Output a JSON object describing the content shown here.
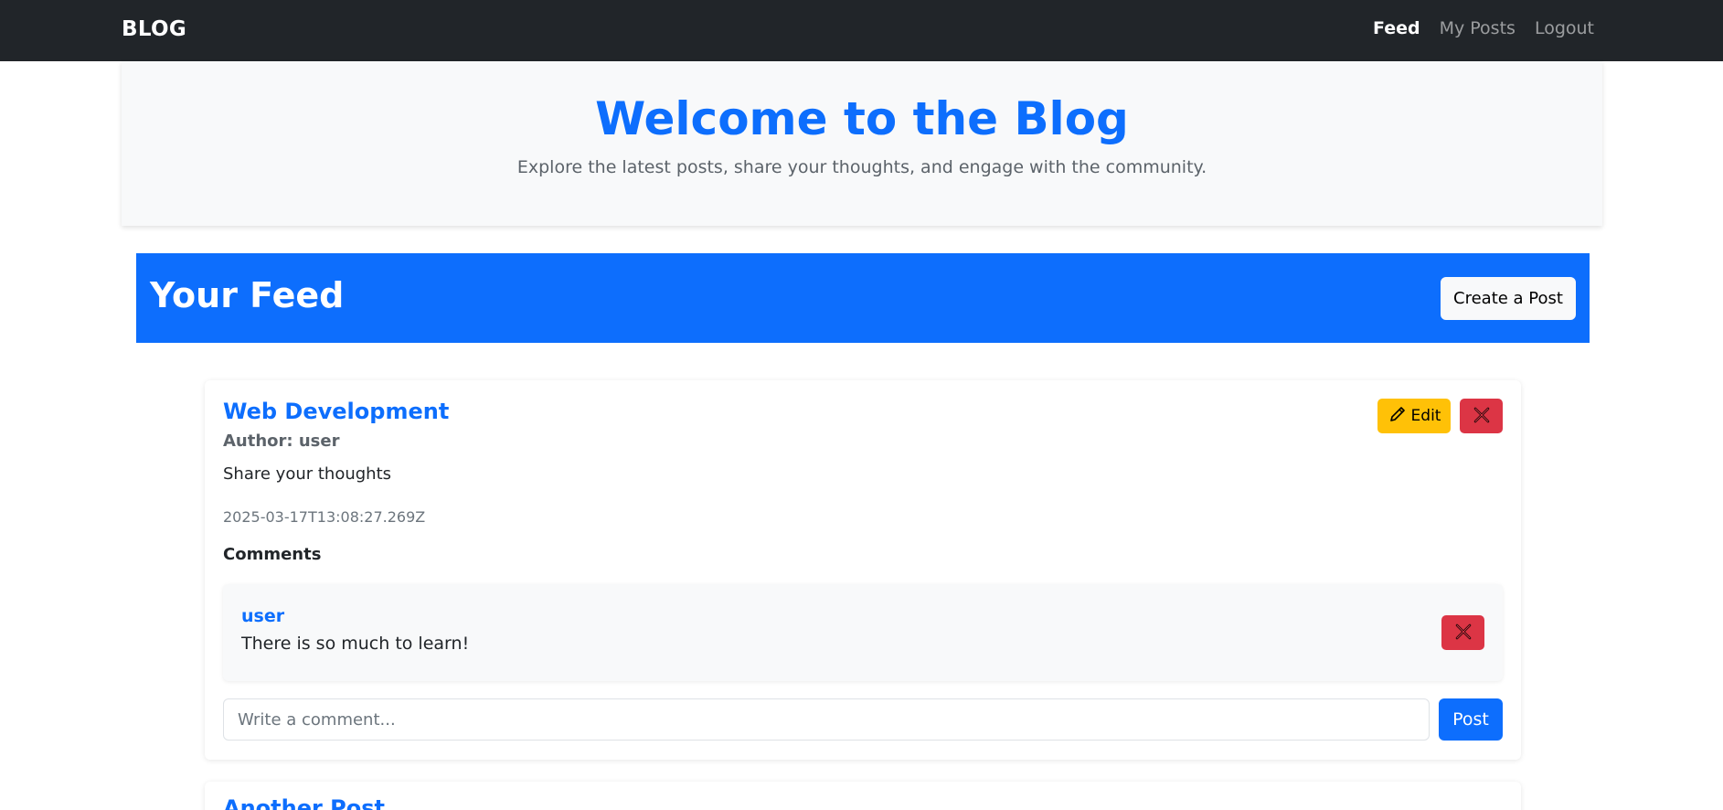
{
  "navbar": {
    "brand": "BLOG",
    "links": [
      {
        "label": "Feed",
        "active": true
      },
      {
        "label": "My Posts",
        "active": false
      },
      {
        "label": "Logout",
        "active": false
      }
    ]
  },
  "hero": {
    "title": "Welcome to the Blog",
    "subtitle": "Explore the latest posts, share your thoughts, and engage with the community."
  },
  "feed": {
    "title": "Your Feed",
    "create_label": "Create a Post"
  },
  "posts": [
    {
      "title": "Web Development",
      "author": "Author: user",
      "body": "Share your thoughts",
      "date": "2025-03-17T13:08:27.269Z",
      "edit_label": "Edit",
      "edit_icon": "pencil-icon",
      "delete_icon": "x-icon",
      "comments_heading": "Comments",
      "comments": [
        {
          "user": "user",
          "text": "There is so much to learn!"
        }
      ],
      "comment_placeholder": "Write a comment...",
      "post_label": "Post"
    },
    {
      "title": "Another Post"
    }
  ],
  "colors": {
    "primary": "#0d6efd",
    "navbar": "#212529",
    "warning": "#ffc107",
    "danger": "#dc3545",
    "light": "#f8f9fa"
  }
}
